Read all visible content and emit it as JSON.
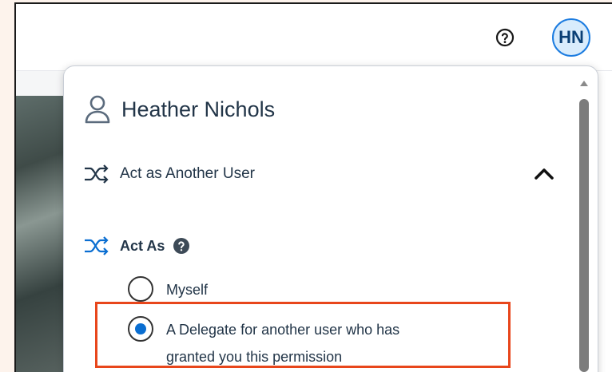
{
  "header": {
    "avatar_initials": "HN",
    "help_icon": "help-circle-icon"
  },
  "profile_menu": {
    "user_name": "Heather Nichols",
    "user_icon": "person-icon",
    "act_as_another_user_label": "Act as Another User",
    "act_as_label": "Act As",
    "options": [
      {
        "label": "Myself",
        "selected": false
      },
      {
        "label_line1": "A Delegate for another user who has",
        "label_line2": "granted you this permission",
        "selected": true
      }
    ]
  },
  "colors": {
    "accent": "#0a6ed1",
    "avatar_bg": "#d9ecfc",
    "highlight": "#e8461b",
    "text": "#223548"
  }
}
